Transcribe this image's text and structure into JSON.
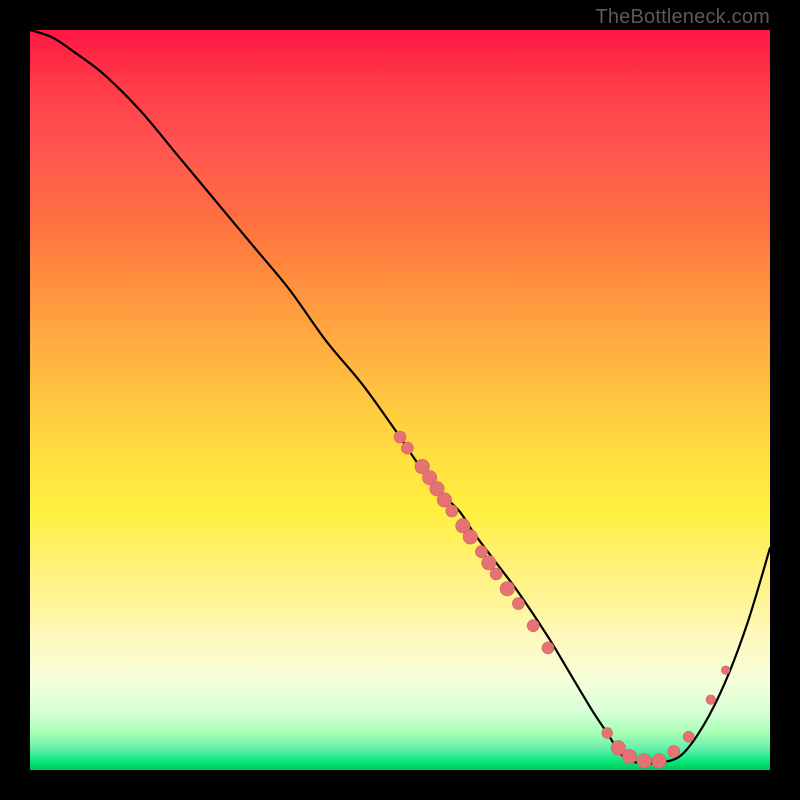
{
  "watermark": "TheBottleneck.com",
  "colors": {
    "curve_stroke": "#000000",
    "dot_fill": "#e57373",
    "dot_stroke": "#d26060",
    "background_black": "#000000"
  },
  "chart_data": {
    "type": "line",
    "title": "",
    "xlabel": "",
    "ylabel": "",
    "xlim": [
      0,
      100
    ],
    "ylim": [
      0,
      100
    ],
    "grid": false,
    "series": [
      {
        "name": "bottleneck-curve",
        "x": [
          0,
          3,
          6,
          10,
          15,
          20,
          25,
          30,
          35,
          40,
          45,
          50,
          52,
          55,
          58,
          60,
          63,
          66,
          70,
          73,
          76,
          78,
          80,
          82,
          85,
          88,
          91,
          94,
          97,
          100
        ],
        "y": [
          100,
          99,
          97,
          94,
          89,
          83,
          77,
          71,
          65,
          58,
          52,
          45,
          42,
          38,
          35,
          32,
          28,
          24,
          18,
          13,
          8,
          5,
          2,
          1,
          1,
          2,
          6,
          12,
          20,
          30
        ]
      }
    ],
    "scatter": [
      {
        "x": 50,
        "y": 45,
        "r": 1.0
      },
      {
        "x": 51,
        "y": 43.5,
        "r": 1.0
      },
      {
        "x": 53,
        "y": 41,
        "r": 1.2
      },
      {
        "x": 54,
        "y": 39.5,
        "r": 1.2
      },
      {
        "x": 55,
        "y": 38,
        "r": 1.2
      },
      {
        "x": 56,
        "y": 36.5,
        "r": 1.2
      },
      {
        "x": 57,
        "y": 35,
        "r": 1.0
      },
      {
        "x": 58.5,
        "y": 33,
        "r": 1.2
      },
      {
        "x": 59.5,
        "y": 31.5,
        "r": 1.2
      },
      {
        "x": 61,
        "y": 29.5,
        "r": 1.0
      },
      {
        "x": 62,
        "y": 28,
        "r": 1.2
      },
      {
        "x": 63,
        "y": 26.5,
        "r": 1.0
      },
      {
        "x": 64.5,
        "y": 24.5,
        "r": 1.2
      },
      {
        "x": 66,
        "y": 22.5,
        "r": 1.0
      },
      {
        "x": 68,
        "y": 19.5,
        "r": 1.0
      },
      {
        "x": 70,
        "y": 16.5,
        "r": 1.0
      },
      {
        "x": 78,
        "y": 5,
        "r": 0.9
      },
      {
        "x": 79.5,
        "y": 3,
        "r": 1.2
      },
      {
        "x": 81,
        "y": 1.8,
        "r": 1.2
      },
      {
        "x": 83,
        "y": 1.2,
        "r": 1.2
      },
      {
        "x": 85,
        "y": 1.2,
        "r": 1.2
      },
      {
        "x": 87,
        "y": 2.5,
        "r": 1.0
      },
      {
        "x": 89,
        "y": 4.5,
        "r": 0.9
      },
      {
        "x": 92,
        "y": 9.5,
        "r": 0.8
      },
      {
        "x": 94,
        "y": 13.5,
        "r": 0.7
      }
    ]
  }
}
